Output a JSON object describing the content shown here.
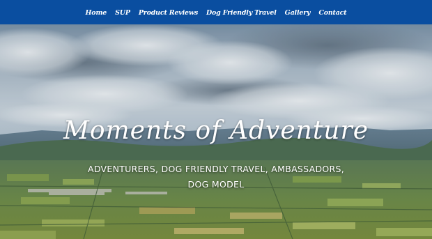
{
  "nav": {
    "items": [
      "Home",
      "SUP",
      "Product Reviews",
      "Dog Friendly Travel",
      "Gallery",
      "Contact"
    ]
  },
  "hero": {
    "title": "Moments of Adventure",
    "tagline": "ADVENTURERS, DOG FRIENDLY TRAVEL, AMBASSADORS, DOG MODEL"
  },
  "colors": {
    "nav_background": "#0a4ea0",
    "text": "#ffffff"
  }
}
